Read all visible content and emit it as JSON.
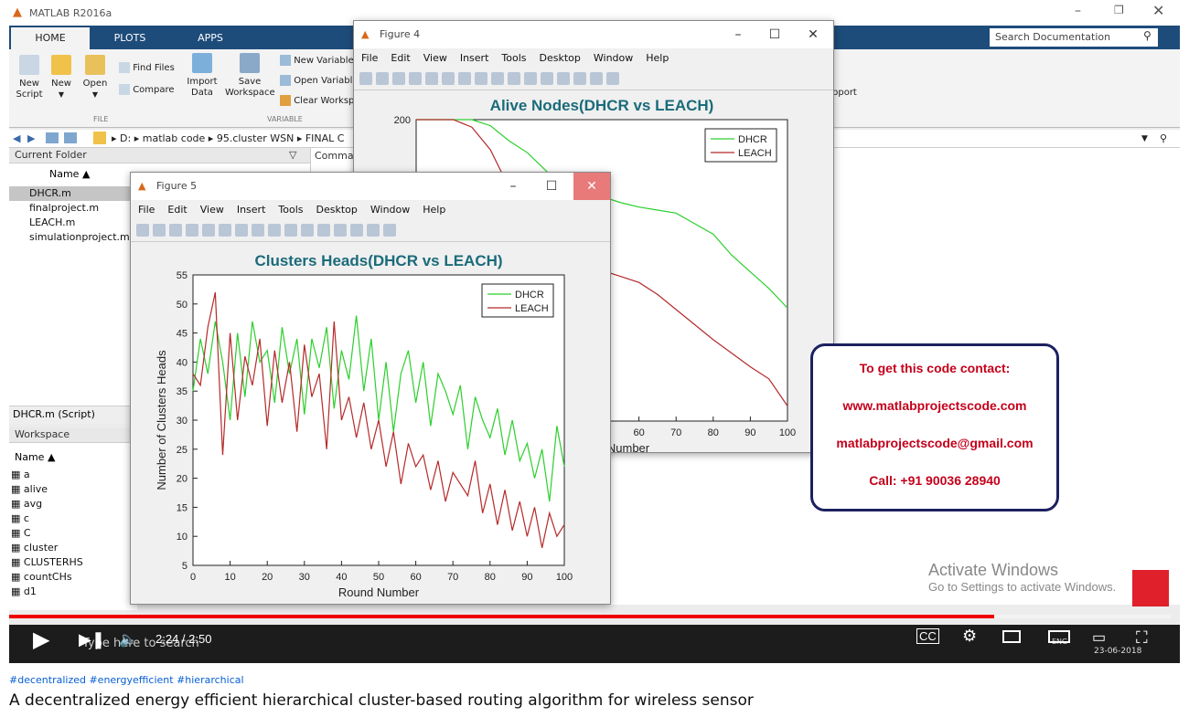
{
  "matlab": {
    "title": "MATLAB R2016a",
    "tabs": [
      "HOME",
      "PLOTS",
      "APPS"
    ],
    "ribbon": {
      "new_script": "New Script",
      "new": "New",
      "open": "Open",
      "find_files": "Find Files",
      "compare": "Compare",
      "import_data": "Import Data",
      "save_workspace": "Save Workspace",
      "new_variable": "New Variable",
      "open_variable": "Open Variable",
      "clear_workspace": "Clear Workspace",
      "group_file": "FILE",
      "group_variable": "VARIABLE",
      "support": "pport"
    },
    "search_placeholder": "Search Documentation",
    "address": [
      "D:",
      "matlab code",
      "95.cluster WSN",
      "FINAL C"
    ],
    "current_folder": {
      "header": "Current Folder",
      "name_col": "Name ▲",
      "files": [
        "DHCR.m",
        "finalproject.m",
        "LEACH.m",
        "simulationproject.m"
      ],
      "details": "DHCR.m (Script)"
    },
    "command_header": "Comma",
    "workspace": {
      "header": "Workspace",
      "name_col": "Name ▲",
      "vars": [
        "a",
        "alive",
        "avg",
        "c",
        "C",
        "cluster",
        "CLUSTERHS",
        "countCHs",
        "d1"
      ]
    }
  },
  "figure4": {
    "title": "Figure 4",
    "menu": [
      "File",
      "Edit",
      "View",
      "Insert",
      "Tools",
      "Desktop",
      "Window",
      "Help"
    ]
  },
  "figure5": {
    "title": "Figure 5",
    "menu": [
      "File",
      "Edit",
      "View",
      "Insert",
      "Tools",
      "Desktop",
      "Window",
      "Help"
    ]
  },
  "contact": {
    "line1": "To get this code contact:",
    "line2": "www.matlabprojectscode.com",
    "line3": "matlabprojectscode@gmail.com",
    "line4": "Call: +91 90036 28940"
  },
  "activate": {
    "title": "Activate Windows",
    "sub": "Go to Settings to activate Windows."
  },
  "player": {
    "time": "2:24 / 2:50",
    "progress": 0.848,
    "search_placeholder": "Type here to search",
    "date": "23-06-2018",
    "lang": "ENG"
  },
  "below": {
    "hashtags": "#decentralized #energyefficient #hierarchical",
    "title": "A decentralized energy efficient hierarchical cluster-based routing algorithm for wireless sensor"
  },
  "chart_data": [
    {
      "type": "line",
      "title": "Alive Nodes(DHCR vs LEACH)",
      "xlabel": "Number",
      "ylabel": "",
      "xlim": [
        0,
        100
      ],
      "ylim": [
        0,
        200
      ],
      "x_ticks": [
        60,
        70,
        80,
        90,
        100
      ],
      "y_ticks": [
        200
      ],
      "legend_position": "top-right",
      "series": [
        {
          "name": "DHCR",
          "color": "#2ccf2c",
          "x": [
            0,
            15,
            20,
            25,
            30,
            35,
            40,
            45,
            50,
            55,
            60,
            65,
            70,
            75,
            80,
            85,
            90,
            95,
            100
          ],
          "y": [
            200,
            200,
            196,
            186,
            178,
            166,
            156,
            150,
            149,
            145,
            142,
            140,
            138,
            131,
            124,
            110,
            99,
            88,
            75
          ]
        },
        {
          "name": "LEACH",
          "color": "#b52a2a",
          "x": [
            0,
            10,
            15,
            20,
            25,
            30,
            35,
            40,
            45,
            50,
            55,
            60,
            65,
            70,
            75,
            80,
            85,
            90,
            95,
            100
          ],
          "y": [
            200,
            200,
            195,
            180,
            155,
            135,
            120,
            110,
            105,
            100,
            96,
            92,
            84,
            74,
            64,
            54,
            45,
            36,
            28,
            10
          ]
        }
      ]
    },
    {
      "type": "line",
      "title": "Clusters Heads(DHCR vs LEACH)",
      "xlabel": "Round Number",
      "ylabel": "Number of Clusters Heads",
      "xlim": [
        0,
        100
      ],
      "ylim": [
        5,
        55
      ],
      "x_ticks": [
        0,
        10,
        20,
        30,
        40,
        50,
        60,
        70,
        80,
        90,
        100
      ],
      "y_ticks": [
        5,
        10,
        15,
        20,
        25,
        30,
        35,
        40,
        45,
        50,
        55
      ],
      "legend_position": "top-right",
      "series": [
        {
          "name": "DHCR",
          "color": "#2ccf2c",
          "x": [
            0,
            2,
            4,
            6,
            8,
            10,
            12,
            14,
            16,
            18,
            20,
            22,
            24,
            26,
            28,
            30,
            32,
            34,
            36,
            38,
            40,
            42,
            44,
            46,
            48,
            50,
            52,
            54,
            56,
            58,
            60,
            62,
            64,
            66,
            68,
            70,
            72,
            74,
            76,
            78,
            80,
            82,
            84,
            86,
            88,
            90,
            92,
            94,
            96,
            98,
            100
          ],
          "y": [
            35,
            44,
            38,
            47,
            40,
            30,
            45,
            34,
            47,
            40,
            42,
            33,
            46,
            38,
            44,
            31,
            44,
            39,
            46,
            32,
            42,
            37,
            48,
            35,
            44,
            30,
            40,
            28,
            38,
            42,
            33,
            40,
            29,
            38,
            35,
            31,
            36,
            25,
            34,
            30,
            27,
            32,
            24,
            30,
            23,
            26,
            20,
            25,
            16,
            29,
            22
          ]
        },
        {
          "name": "LEACH",
          "color": "#b52a2a",
          "x": [
            0,
            2,
            4,
            6,
            8,
            10,
            12,
            14,
            16,
            18,
            20,
            22,
            24,
            26,
            28,
            30,
            32,
            34,
            36,
            38,
            40,
            42,
            44,
            46,
            48,
            50,
            52,
            54,
            56,
            58,
            60,
            62,
            64,
            66,
            68,
            70,
            72,
            74,
            76,
            78,
            80,
            82,
            84,
            86,
            88,
            90,
            92,
            94,
            96,
            98,
            100
          ],
          "y": [
            38,
            36,
            46,
            52,
            24,
            45,
            30,
            41,
            36,
            44,
            29,
            42,
            33,
            40,
            28,
            43,
            34,
            38,
            25,
            47,
            30,
            34,
            27,
            33,
            25,
            30,
            22,
            28,
            19,
            26,
            22,
            24,
            18,
            23,
            16,
            21,
            19,
            17,
            23,
            14,
            19,
            12,
            18,
            11,
            16,
            10,
            15,
            8,
            14,
            10,
            12
          ]
        }
      ]
    }
  ]
}
